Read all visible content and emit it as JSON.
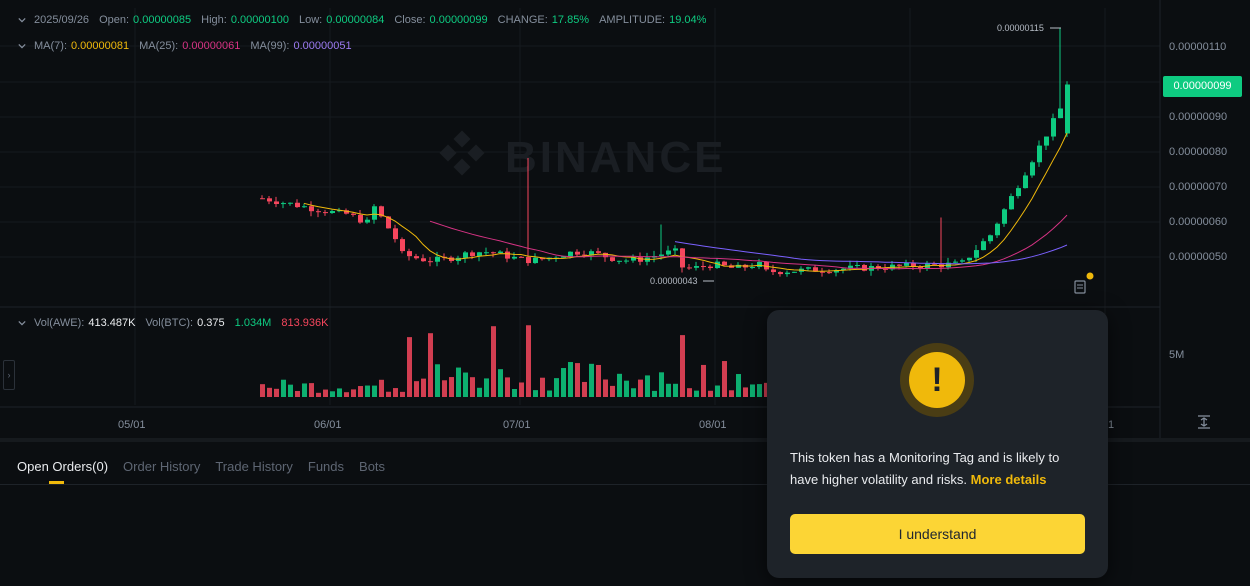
{
  "ohlc": {
    "date": "2025/09/26",
    "open_label": "Open:",
    "open": "0.00000085",
    "high_label": "High:",
    "high": "0.00000100",
    "low_label": "Low:",
    "low": "0.00000084",
    "close_label": "Close:",
    "close": "0.00000099",
    "change_label": "CHANGE:",
    "change": "17.85%",
    "amplitude_label": "AMPLITUDE:",
    "amplitude": "19.04%"
  },
  "ma": {
    "ma7_label": "MA(7):",
    "ma7": "0.00000081",
    "ma25_label": "MA(25):",
    "ma25": "0.00000061",
    "ma99_label": "MA(99):",
    "ma99": "0.00000051"
  },
  "vol": {
    "awe_label": "Vol(AWE):",
    "awe": "413.487K",
    "btc_label": "Vol(BTC):",
    "btc": "0.375",
    "v1": "1.034M",
    "v2": "813.936K"
  },
  "price_axis": [
    "0.00000110",
    "0.00000090",
    "0.00000080",
    "0.00000070",
    "0.00000060",
    "0.00000050"
  ],
  "volume_axis": [
    "5M"
  ],
  "current_price": "0.00000099",
  "high_annotation": "0.00000115",
  "low_annotation": "0.00000043",
  "x_axis": [
    "05/01",
    "06/01",
    "07/01",
    "08/01",
    "1"
  ],
  "watermark": "BINANCE",
  "tabs": [
    {
      "label": "Open Orders(0)"
    },
    {
      "label": "Order History"
    },
    {
      "label": "Trade History"
    },
    {
      "label": "Funds"
    },
    {
      "label": "Bots"
    }
  ],
  "modal": {
    "text": "This token has a Monitoring Tag and is likely to have higher volatility and risks.",
    "link": "More details",
    "button": "I understand"
  },
  "colors": {
    "up": "#0ecb81",
    "down": "#f6465d",
    "ma7": "#f0b90b",
    "ma25": "#d63384",
    "ma99": "#7b61ff",
    "accent": "#fcd535"
  },
  "icons": [
    "chevron-down-icon",
    "exclamation-icon",
    "fit-screen-icon",
    "layers-icon"
  ]
}
